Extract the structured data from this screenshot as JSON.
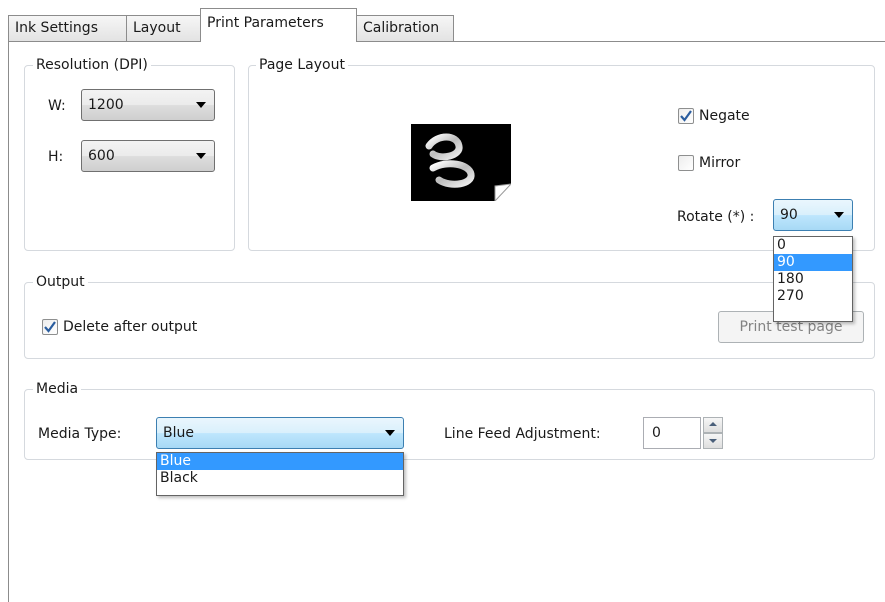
{
  "tabs": [
    {
      "label": "Ink Settings"
    },
    {
      "label": "Layout"
    },
    {
      "label": "Print Parameters"
    },
    {
      "label": "Calibration"
    }
  ],
  "active_tab": "Print Parameters",
  "resolution": {
    "title": "Resolution (DPI)",
    "w_label": "W:",
    "w_value": "1200",
    "h_label": "H:",
    "h_value": "600"
  },
  "page_layout": {
    "title": "Page Layout",
    "negate_label": "Negate",
    "negate_checked": true,
    "mirror_label": "Mirror",
    "mirror_checked": false,
    "rotate_label": "Rotate (*) :",
    "rotate_value": "90",
    "rotate_options": [
      "0",
      "90",
      "180",
      "270"
    ],
    "rotate_selected_index": 1
  },
  "output": {
    "title": "Output",
    "delete_label": "Delete after output",
    "delete_checked": true,
    "print_test_label": "Print test page"
  },
  "media": {
    "title": "Media",
    "type_label": "Media Type:",
    "type_value": "Blue",
    "type_options": [
      "Blue",
      "Black"
    ],
    "type_selected_index": 0,
    "line_feed_label": "Line Feed Adjustment:",
    "line_feed_value": "0"
  },
  "colors": {
    "selection": "#3399ff",
    "focus_border": "#3c7fb1",
    "check_mark": "#2a5d9f"
  }
}
